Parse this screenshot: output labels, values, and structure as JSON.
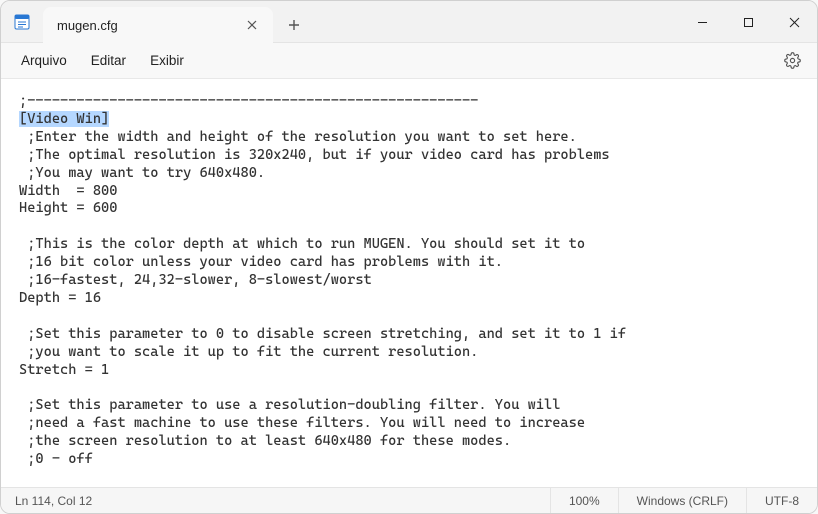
{
  "titlebar": {
    "tab_label": "mugen.cfg"
  },
  "menubar": {
    "file": "Arquivo",
    "edit": "Editar",
    "view": "Exibir"
  },
  "editor": {
    "l01": ";-------------------------------------------------------",
    "section_header": "[Video Win]",
    "l03": " ;Enter the width and height of the resolution you want to set here.",
    "l04": " ;The optimal resolution is 320x240, but if your video card has problems",
    "l05": " ;You may want to try 640x480.",
    "l06": "Width  = 800",
    "l07": "Height = 600",
    "l08": "",
    "l09": " ;This is the color depth at which to run MUGEN. You should set it to",
    "l10": " ;16 bit color unless your video card has problems with it.",
    "l11": " ;16-fastest, 24,32-slower, 8-slowest/worst",
    "l12": "Depth = 16",
    "l13": "",
    "l14": " ;Set this parameter to 0 to disable screen stretching, and set it to 1 if",
    "l15": " ;you want to scale it up to fit the current resolution.",
    "l16": "Stretch = 1",
    "l17": "",
    "l18": " ;Set this parameter to use a resolution-doubling filter. You will",
    "l19": " ;need a fast machine to use these filters. You will need to increase",
    "l20": " ;the screen resolution to at least 640x480 for these modes.",
    "l21": " ;0 - off"
  },
  "statusbar": {
    "cursor": "Ln 114, Col 12",
    "zoom": "100%",
    "eol": "Windows (CRLF)",
    "encoding": "UTF-8"
  }
}
